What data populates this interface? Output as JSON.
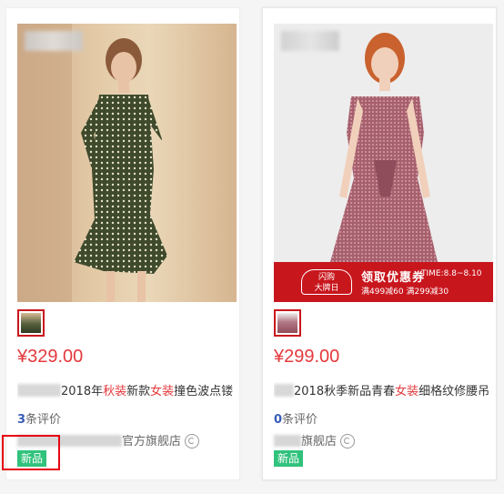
{
  "products": [
    {
      "price": "¥329.00",
      "title_prefix": "2018年",
      "title_red1": "秋装",
      "title_mid": "新款",
      "title_red2": "女装",
      "title_suffix": "撞色波点镂",
      "review_count": "3",
      "review_label": "条评价",
      "shop_name": "官方旗舰店",
      "tag": "新品",
      "tag_highlighted": true
    },
    {
      "price": "¥299.00",
      "title_prefix": "2018秋季新品青春",
      "title_red": "女装",
      "title_suffix": "细格纹修腰吊",
      "review_count": "0",
      "review_label": "条评价",
      "shop_name": "旗舰店",
      "tag": "新品",
      "promo": {
        "badge_line1": "闪购",
        "badge_line2": "大牌日",
        "coupon": "领取优惠券",
        "time": "TIME:8.8~8.10",
        "rules": "满499减60 满299减30"
      }
    }
  ],
  "colors": {
    "price": "#e4393c",
    "tag": "#31c27c",
    "review_count": "#375cb8",
    "promo_bg": "#c8161d",
    "highlight": "#e60012"
  }
}
